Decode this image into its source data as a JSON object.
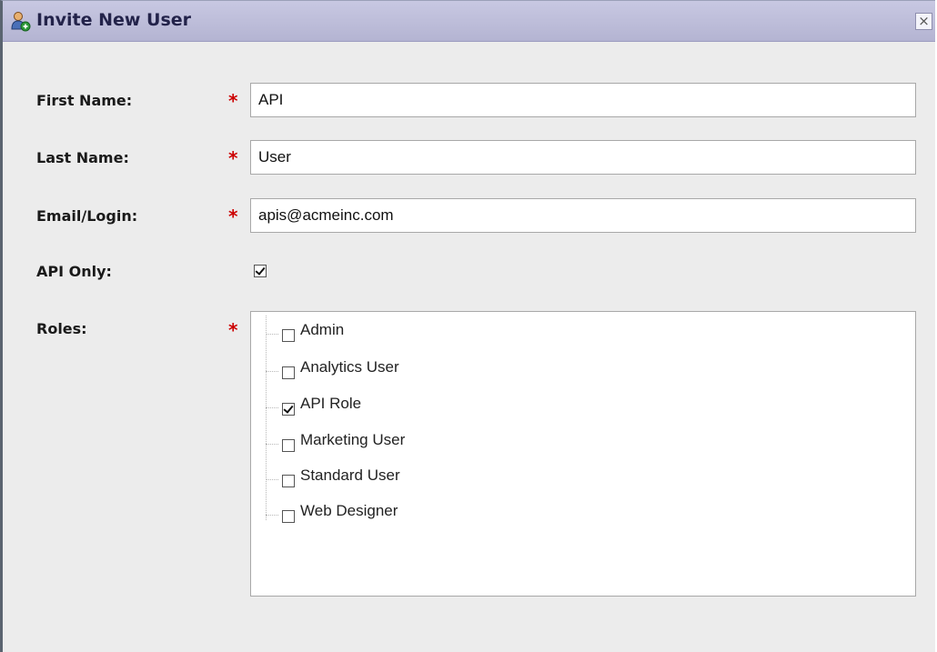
{
  "dialog": {
    "title": "Invite New User",
    "title_icon": "add-user-icon",
    "close_icon": "close-icon",
    "close_glyph": "×"
  },
  "form": {
    "first_name": {
      "label": "First Name:",
      "value": "API",
      "required": true
    },
    "last_name": {
      "label": "Last Name:",
      "value": "User",
      "required": true
    },
    "email": {
      "label": "Email/Login:",
      "value": "apis@acmeinc.com",
      "required": true
    },
    "api_only": {
      "label": "API Only:",
      "checked": true
    },
    "roles": {
      "label": "Roles:",
      "required": true,
      "items": [
        {
          "label": "Admin",
          "checked": false
        },
        {
          "label": "Analytics User",
          "checked": false
        },
        {
          "label": "API Role",
          "checked": true
        },
        {
          "label": "Marketing User",
          "checked": false
        },
        {
          "label": "Standard User",
          "checked": false
        },
        {
          "label": "Web Designer",
          "checked": false
        }
      ]
    }
  },
  "required_marker": "*",
  "colors": {
    "titlebar": "#b8b8d6",
    "title_text": "#23234a",
    "required": "#cc0000",
    "background": "#ececec"
  }
}
